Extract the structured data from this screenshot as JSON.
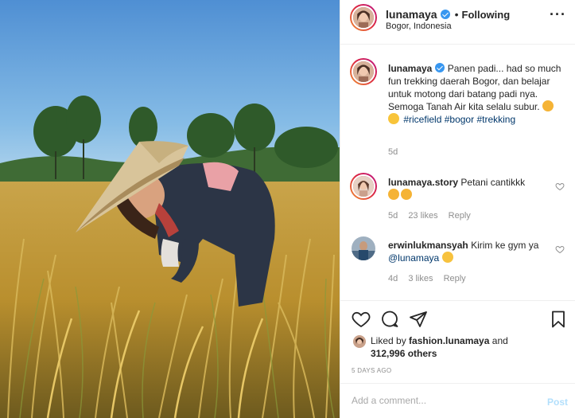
{
  "post": {
    "username": "lunamaya",
    "follow_status": "Following",
    "separator": "•",
    "location": "Bogor, Indonesia",
    "more_icon": "more-options-icon"
  },
  "caption": {
    "username": "lunamaya",
    "text": "Panen padi... had so much fun trekking daerah Bogor, dan belajar untuk motong dari batang padi nya. Semoga Tanah Air kita selalu subur.",
    "emojis": [
      "heart-eyes-emoji",
      "smiling-emoji"
    ],
    "hashtags": [
      "#ricefield",
      "#bogor",
      "#trekking"
    ],
    "age": "5d"
  },
  "comments": [
    {
      "username": "lunamaya.story",
      "text": "Petani cantikkk",
      "emojis": [
        "heart-eyes-emoji",
        "heart-eyes-emoji"
      ],
      "age": "5d",
      "likes": "23 likes",
      "reply": "Reply"
    },
    {
      "username": "erwinlukmansyah",
      "text": "Kirim ke gym ya",
      "mention": "@lunamaya",
      "emojis": [
        "rolling-laughing-emoji"
      ],
      "age": "4d",
      "likes": "3 likes",
      "reply": "Reply"
    }
  ],
  "likes": {
    "prefix": "Liked by",
    "user": "fashion.lunamaya",
    "conj": "and",
    "count": "312,996 others"
  },
  "timestamp": "5 DAYS AGO",
  "add_comment": {
    "placeholder": "Add a comment...",
    "post_label": "Post"
  },
  "colors": {
    "link": "#00376b",
    "verified": "#3897f0",
    "muted": "#8e8e8e",
    "post_disabled": "#b2dffc"
  },
  "icons": [
    "heart-icon",
    "comment-icon",
    "share-icon",
    "bookmark-icon",
    "verified-badge-icon"
  ]
}
